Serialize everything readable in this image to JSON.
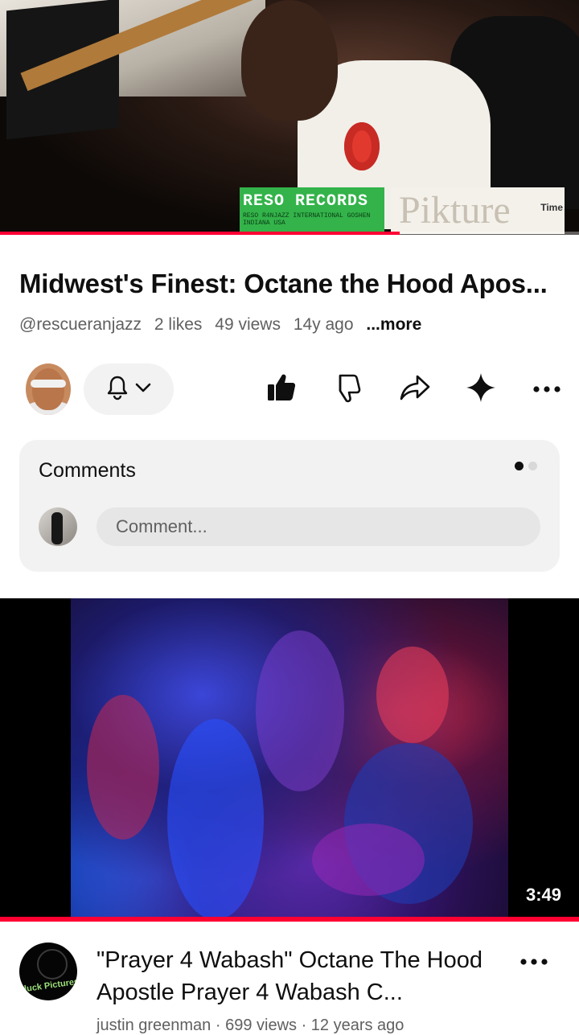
{
  "player": {
    "overlay_reso_title": "RESO RECORDS",
    "overlay_reso_sub": "RESO R4NJAZZ INTERNATIONAL GOSHEN INDIANA USA",
    "overlay_pikture": "Pikture",
    "overlay_pikture_tm": "Time",
    "progress_fraction": 0.69
  },
  "video": {
    "title": "Midwest's Finest: Octane the Hood Apos...",
    "channel_handle": "@rescueranjazz",
    "likes": "2 likes",
    "views": "49 views",
    "age": "14y ago",
    "more_label": "...more"
  },
  "actions": {
    "icons": [
      "channel-avatar",
      "bell-icon",
      "chevron-down-icon",
      "thumbs-up-icon",
      "thumbs-down-icon",
      "share-icon",
      "sparkle-icon",
      "more-icon"
    ]
  },
  "comments": {
    "heading": "Comments",
    "placeholder": "Comment..."
  },
  "next_video": {
    "duration": "3:49",
    "avatar_text": "Dluck Pictures",
    "title": "\"Prayer 4 Wabash\" Octane The Hood Apostle Prayer 4 Wabash C...",
    "meta": "justin greenman · 699 views · 12 years ago"
  },
  "colors": {
    "accent": "#ff0033",
    "text_primary": "#0f0f0f",
    "text_secondary": "#606060",
    "card_bg": "#f2f2f2"
  }
}
